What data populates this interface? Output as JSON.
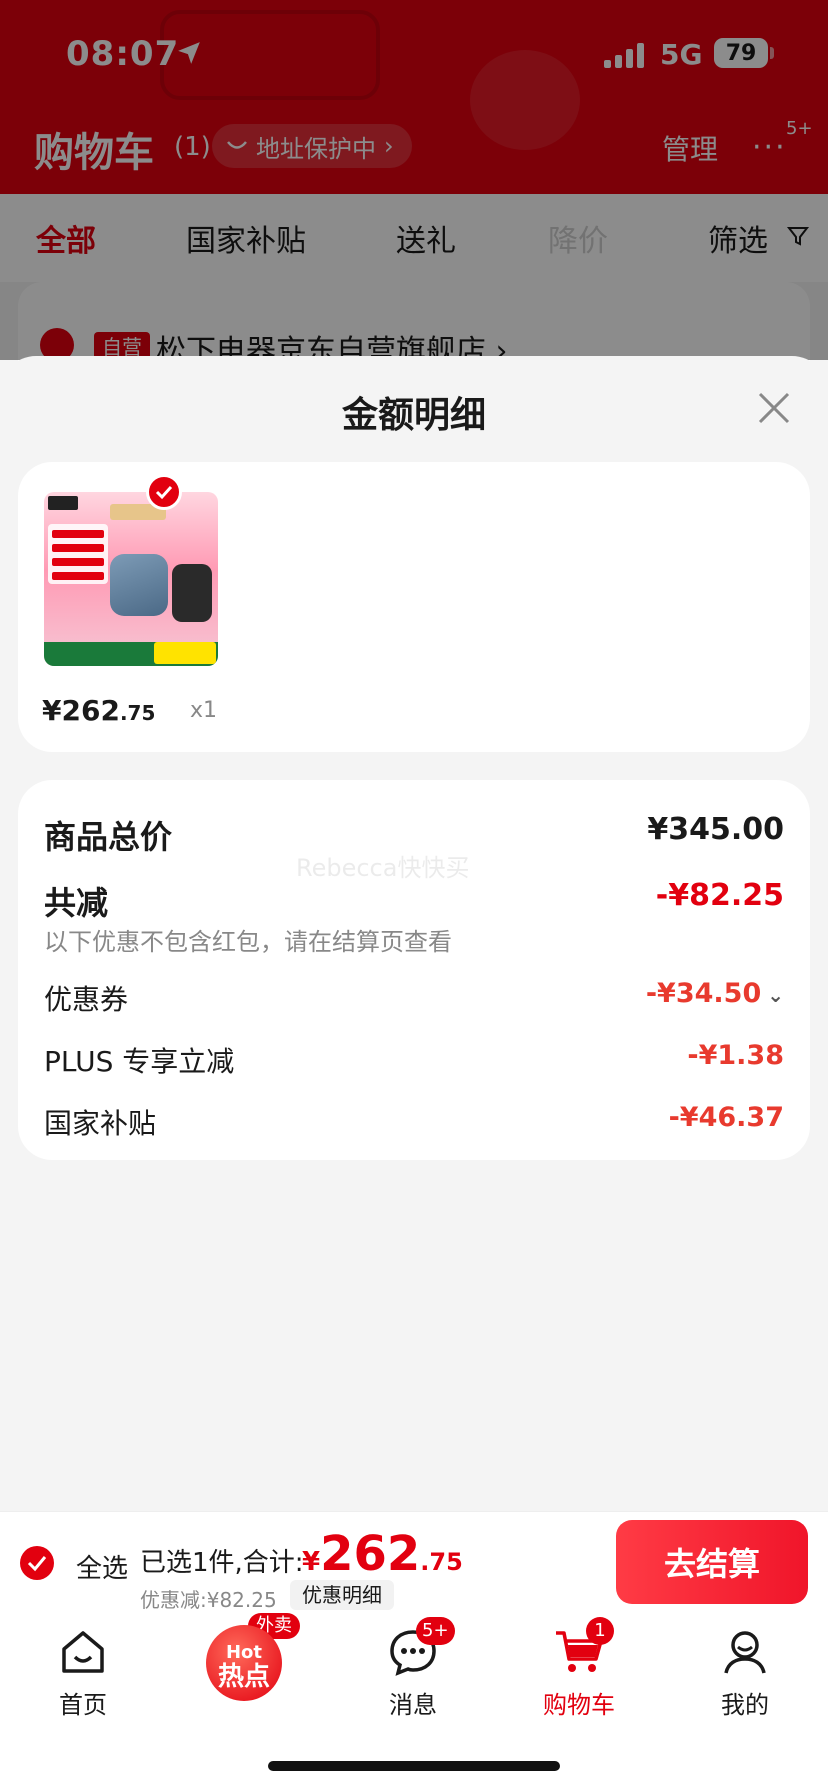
{
  "status_bar": {
    "time": "08:07",
    "network": "5G",
    "battery": "79"
  },
  "header": {
    "title": "购物车",
    "count": "(1)",
    "address_protect": "地址保护中",
    "manage": "管理",
    "more_badge": "5+"
  },
  "tabs": [
    {
      "label": "全部"
    },
    {
      "label": "国家补贴"
    },
    {
      "label": "送礼"
    },
    {
      "label": "降价"
    },
    {
      "label": "筛选"
    }
  ],
  "store": {
    "tag": "自营",
    "name": "松下电器京东自营旗舰店 ›"
  },
  "sheet": {
    "title": "金额明细",
    "watermark": "Rebecca快快买",
    "product": {
      "price_int": "¥262",
      "price_dec": ".75",
      "qty": "x1"
    },
    "summary": {
      "total_label": "商品总价",
      "total_value": "¥345.00",
      "reduce_label": "共减",
      "reduce_value": "-¥82.25",
      "note": "以下优惠不包含红包，请在结算页查看",
      "items": [
        {
          "label": "优惠券",
          "value": "-¥34.50"
        },
        {
          "label": "PLUS 专享立减",
          "value": "-¥1.38"
        },
        {
          "label": "国家补贴",
          "value": "-¥46.37"
        }
      ]
    }
  },
  "checkout": {
    "select_all": "全选",
    "selected": "已选1件,合计:",
    "total_cur": "¥",
    "total_int": "262",
    "total_dec": ".75",
    "discount": "优惠减:¥82.25",
    "detail": "优惠明细",
    "button": "去结算"
  },
  "tabbar": {
    "items": [
      {
        "label": "首页"
      },
      {
        "label": ""
      },
      {
        "label": "消息",
        "badge": "5+"
      },
      {
        "label": "购物车",
        "badge": "1"
      },
      {
        "label": "我的"
      }
    ],
    "hot": {
      "tag": "外卖",
      "line1": "Hot",
      "line2": "热点"
    }
  },
  "colors": {
    "brand_red": "#e2000f",
    "background": "#f4f4f4"
  }
}
